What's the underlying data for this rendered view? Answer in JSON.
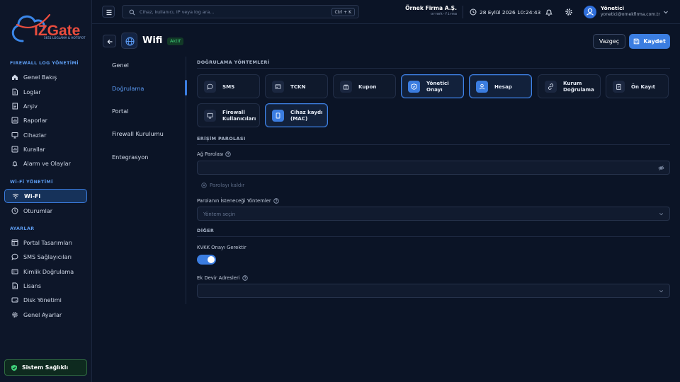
{
  "brand": {
    "name": "IZGate",
    "tagline": "5651 LOGLAMA & HOTSPOT"
  },
  "sidebar": {
    "sections": [
      {
        "title": "FIREWALL LOG YÖNETİMİ",
        "items": [
          {
            "label": "Genel Bakış",
            "icon": "home-icon"
          },
          {
            "label": "Loglar",
            "icon": "document-icon"
          },
          {
            "label": "Arşiv",
            "icon": "archive-icon"
          },
          {
            "label": "Raporlar",
            "icon": "report-icon"
          },
          {
            "label": "Cihazlar",
            "icon": "monitor-icon"
          },
          {
            "label": "Kurallar",
            "icon": "rules-icon"
          },
          {
            "label": "Alarm ve Olaylar",
            "icon": "bell-icon"
          }
        ]
      },
      {
        "title": "Wİ-Fİ YÖNETİMİ",
        "items": [
          {
            "label": "Wi-Fi",
            "icon": "wifi-icon",
            "active": true
          },
          {
            "label": "Oturumlar",
            "icon": "clock-icon"
          }
        ]
      },
      {
        "title": "AYARLAR",
        "items": [
          {
            "label": "Portal Tasarımları",
            "icon": "layout-icon"
          },
          {
            "label": "SMS Sağlayıcıları",
            "icon": "chat-icon"
          },
          {
            "label": "Kimlik Doğrulama",
            "icon": "id-card-icon"
          },
          {
            "label": "Lisans",
            "icon": "license-icon"
          },
          {
            "label": "Disk Yönetimi",
            "icon": "disk-icon"
          },
          {
            "label": "Genel Ayarlar",
            "icon": "gear-icon"
          }
        ]
      }
    ],
    "health_label": "Sistem Sağlıklı"
  },
  "header": {
    "search_placeholder": "Cihaz, kullanıcı, IP veya log ara...",
    "search_shortcut": "Ctrl + K",
    "company_name": "Örnek Firma A.Ş.",
    "company_slug": "ornek-firma",
    "datetime": "28 Eylül 2026 10:24:43",
    "user_name": "Yönetici",
    "user_email": "yonetici@ornekfirma.com.tr"
  },
  "page": {
    "title": "Wifi",
    "status": "Aktif",
    "cancel_label": "Vazgeç",
    "save_label": "Kaydet"
  },
  "subnav": {
    "items": [
      "Genel",
      "Doğrulama",
      "Portal",
      "Firewall Kurulumu",
      "Entegrasyon"
    ],
    "active": "Doğrulama"
  },
  "content": {
    "methods_title": "DOĞRULAMA YÖNTEMLERİ",
    "methods": [
      {
        "label": "SMS",
        "icon": "chat-icon",
        "selected": false
      },
      {
        "label": "TCKN",
        "icon": "id-card-icon",
        "selected": false
      },
      {
        "label": "Kupon",
        "icon": "gift-icon",
        "selected": false
      },
      {
        "label": "Yönetici Onayı",
        "icon": "shield-icon",
        "selected": true
      },
      {
        "label": "Hesap",
        "icon": "user-icon",
        "selected": true
      },
      {
        "label": "Kurum Doğrulama",
        "icon": "link-icon",
        "selected": false
      },
      {
        "label": "Ön Kayıt",
        "icon": "clipboard-icon",
        "selected": false
      },
      {
        "label": "Firewall Kullanıcıları",
        "icon": "monitor-icon",
        "selected": false
      },
      {
        "label": "Cihaz kaydı (MAC)",
        "icon": "tablet-icon",
        "selected": true
      }
    ],
    "access_title": "ERİŞİM PAROLASI",
    "network_password_label": "Ağ Parolası",
    "network_password_value": "",
    "remove_password_label": "Parolayı kaldır",
    "password_methods_label": "Parolanın İsteneceği Yöntemler",
    "password_methods_placeholder": "Yöntem seçin",
    "other_title": "DİĞER",
    "kvkk_label": "KVKK Onayı Gerektir",
    "kvkk_enabled": true,
    "extra_label": "Ek Devir Adresleri",
    "extra_value": ""
  },
  "colors": {
    "accent": "#3b7de0",
    "background": "#0b1426",
    "success": "#3fcf7a"
  }
}
